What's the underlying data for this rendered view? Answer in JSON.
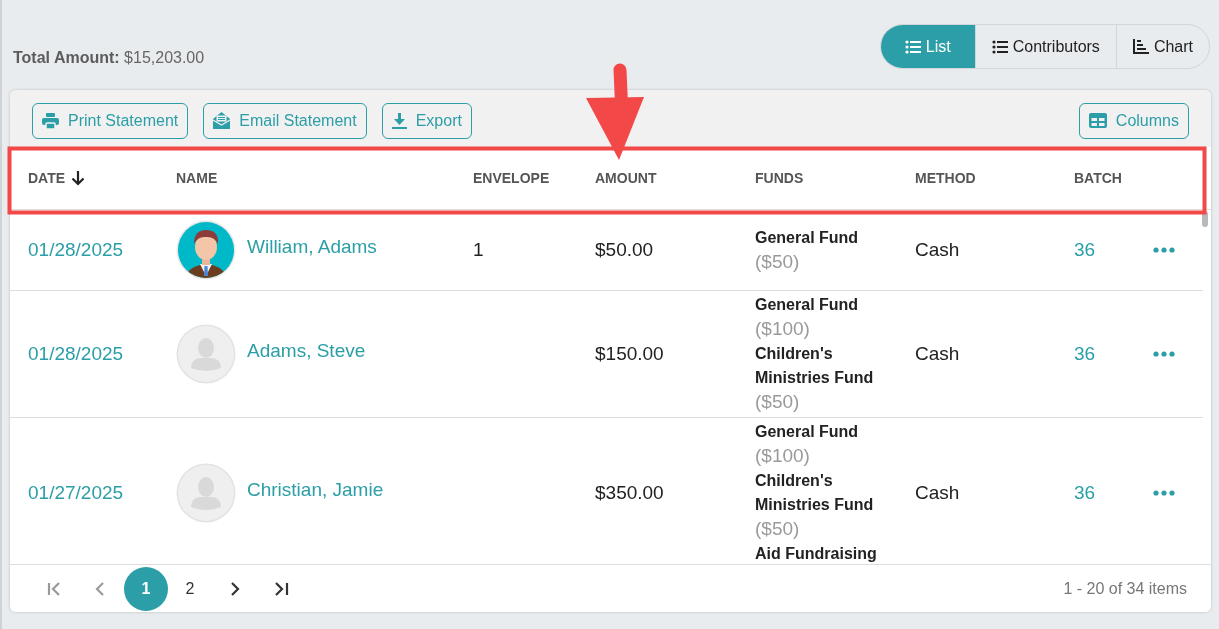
{
  "total": {
    "label": "Total Amount:",
    "value": "$15,203.00"
  },
  "view_tabs": [
    {
      "label": "List",
      "kind": "list",
      "selected": true
    },
    {
      "label": "Contributors",
      "kind": "contributors",
      "selected": false
    },
    {
      "label": "Chart",
      "kind": "chart",
      "selected": false
    }
  ],
  "toolbar": [
    {
      "label": "Print Statement",
      "kind": "print"
    },
    {
      "label": "Email Statement",
      "kind": "email"
    },
    {
      "label": "Export",
      "kind": "export"
    },
    {
      "label": "Columns",
      "kind": "columns"
    }
  ],
  "table": {
    "columns": [
      {
        "label": "DATE",
        "sorted": true
      },
      {
        "label": "NAME",
        "sorted": false
      },
      {
        "label": "ENVELOPE",
        "sorted": false
      },
      {
        "label": "AMOUNT",
        "sorted": false
      },
      {
        "label": "FUNDS",
        "sorted": false
      },
      {
        "label": "METHOD",
        "sorted": false
      },
      {
        "label": "BATCH",
        "sorted": false
      }
    ],
    "rows": [
      {
        "date": "01/28/2025",
        "avatar": {
          "kind": "photo"
        },
        "name": "William, Adams",
        "envelope": "1",
        "amount": "$50.00",
        "funds": [
          {
            "name": "General Fund",
            "amount": "($50)"
          }
        ],
        "method": "Cash",
        "batch": "36"
      },
      {
        "date": "01/28/2025",
        "avatar": {
          "kind": "placeholder"
        },
        "name": "Adams, Steve",
        "amount": "$150.00",
        "funds": [
          {
            "name": "General Fund",
            "amount": "($100)"
          },
          {
            "name": "Children's Ministries Fund",
            "amount": "($50)"
          }
        ],
        "method": "Cash",
        "batch": "36"
      },
      {
        "date": "01/27/2025",
        "avatar": {
          "kind": "placeholder"
        },
        "name": "Christian, Jamie",
        "amount": "$350.00",
        "funds": [
          {
            "name": "General Fund",
            "amount": "($100)"
          },
          {
            "name": "Children's Ministries Fund",
            "amount": "($50)"
          },
          {
            "name": "Aid Fundraising"
          }
        ],
        "method": "Cash",
        "batch": "36"
      }
    ]
  },
  "pager": {
    "nav": [
      {
        "kind": "first",
        "disabled": true
      },
      {
        "kind": "prev",
        "disabled": true
      },
      {
        "kind": "next",
        "disabled": false
      },
      {
        "kind": "last",
        "disabled": false
      }
    ],
    "pages": [
      {
        "label": "1",
        "selected": true
      },
      {
        "label": "2",
        "selected": false
      }
    ],
    "summary": "1 - 20 of 34 items"
  }
}
